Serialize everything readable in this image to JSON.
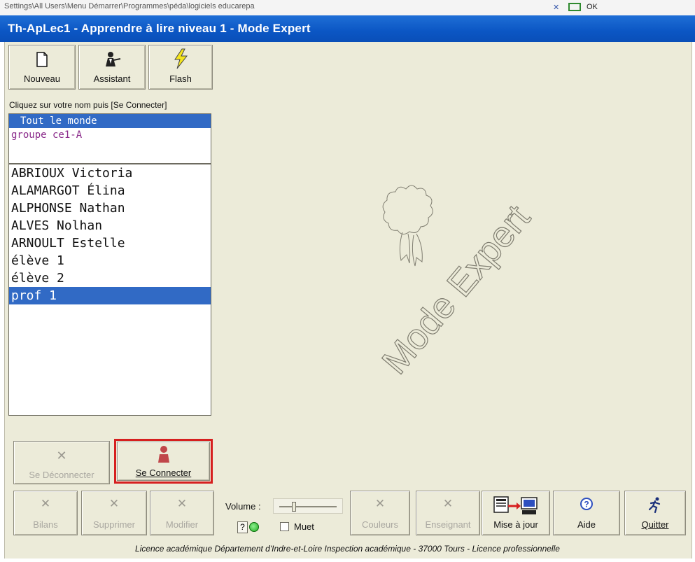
{
  "behind_window": {
    "path_text": "Settings\\All Users\\Menu Démarrer\\Programmes\\péda\\logiciels educarepa",
    "ok_text": "OK"
  },
  "window": {
    "title": "Th-ApLec1 - Apprendre à lire niveau 1 - Mode Expert"
  },
  "toolbar": {
    "new_label": "Nouveau",
    "assistant_label": "Assistant",
    "flash_label": "Flash"
  },
  "hint": "Cliquez sur votre nom puis [Se Connecter]",
  "groups": [
    "Tout le monde",
    "groupe ce1-A"
  ],
  "students": [
    "ABRIOUX Victoria",
    "ALAMARGOT Élina",
    "ALPHONSE Nathan",
    "ALVES Nolhan",
    "ARNOULT Estelle",
    "élève 1",
    "élève 2",
    "prof 1"
  ],
  "selected_student_index": 7,
  "connect": {
    "disconnect_label": "Se Déconnecter",
    "connect_label": "Se Connecter",
    "highlight_color": "#d61f1f"
  },
  "bottom": {
    "bilans_label": "Bilans",
    "supprimer_label": "Supprimer",
    "modifier_label": "Modifier",
    "volume_label": "Volume :",
    "help_q": "?",
    "mute_label": "Muet",
    "couleurs_label": "Couleurs",
    "enseignant_label": "Enseignant",
    "update_label": "Mise à jour",
    "aide_label": "Aide",
    "quitter_label": "Quitter"
  },
  "watermark_text": "Mode Expert",
  "status_text": "Licence académique Département d'Indre-et-Loire Inspection académique - 37000 Tours - Licence professionnelle",
  "colors": {
    "title_blue": "#0b56c4",
    "selection_blue": "#316ac5",
    "group_purple": "#8b2b8b",
    "panel_beige": "#ecebd9"
  }
}
